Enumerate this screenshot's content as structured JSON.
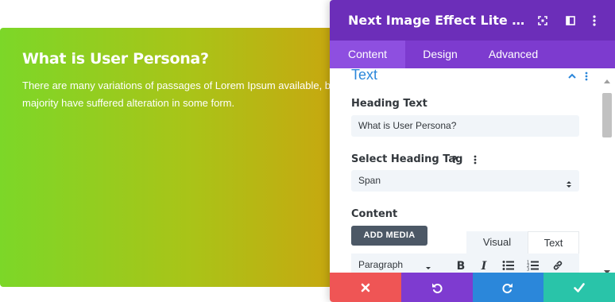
{
  "preview": {
    "title": "What is User Persona?",
    "body_line1": "There are many variations of passages of Lorem Ipsum available, but the",
    "body_line2": "majority have suffered alteration in some form."
  },
  "panel": {
    "title": "Next Image Effect Lite Settings",
    "tabs": [
      {
        "label": "Content",
        "active": true
      },
      {
        "label": "Design",
        "active": false
      },
      {
        "label": "Advanced",
        "active": false
      }
    ],
    "section_title": "Text",
    "heading_text": {
      "label": "Heading Text",
      "value": "What is User Persona?"
    },
    "heading_tag": {
      "label": "Select Heading Tag",
      "value": "Span"
    },
    "content": {
      "label": "Content",
      "add_media_label": "ADD MEDIA",
      "editor_tabs": [
        "Visual",
        "Text"
      ],
      "format_value": "Paragraph"
    }
  },
  "colors": {
    "header": "#6c2eb9",
    "tabs_bar": "#7d3bcf",
    "section_accent": "#2b87da",
    "cancel": "#ef5555",
    "undo": "#7e3bd0",
    "redo": "#2b87da",
    "save": "#29c4a9"
  },
  "icons": {
    "header": [
      "fullscreen-icon",
      "split-view-icon",
      "more-options-icon"
    ],
    "footer": [
      "close-icon",
      "undo-icon",
      "redo-icon",
      "check-icon"
    ],
    "toolbar": [
      "bold-icon",
      "italic-icon",
      "bullet-list-icon",
      "numbered-list-icon",
      "link-icon"
    ]
  }
}
